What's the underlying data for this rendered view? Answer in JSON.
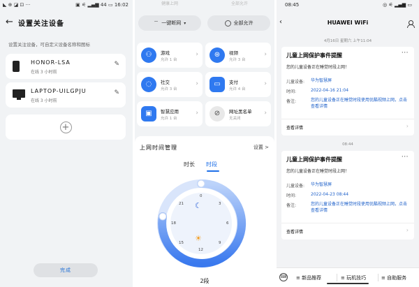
{
  "panel1": {
    "status_left": "◣ ⊕ ◪ ⊡ ···",
    "status_right": "▣ ⚟ ▂▄▆ 44 ▭ 16:02",
    "title": "设置关注设备",
    "description": "设置关注设备，可自定义设备名称和图标",
    "devices": [
      {
        "name": "HONOR-LSA",
        "sub": "在线 3 小时前"
      },
      {
        "name": "LAPTOP-UILGPJU",
        "sub": "在线 3 小时前"
      }
    ],
    "add_symbol": "+",
    "done_label": "完成"
  },
  "panel2": {
    "top_labels": [
      "健康上网",
      "全部允许"
    ],
    "pill1": {
      "label": "一键断网"
    },
    "pill2": {
      "label": "全部允许"
    },
    "tiles": [
      {
        "name": "游戏",
        "sub": "允许 1 台",
        "icon": "game-icon"
      },
      {
        "name": "视频",
        "sub": "允许 3 台",
        "icon": "video-icon"
      },
      {
        "name": "社交",
        "sub": "允许 3 台",
        "icon": "chat-icon"
      },
      {
        "name": "支付",
        "sub": "允许 4 台",
        "icon": "wallet-icon"
      },
      {
        "name": "智慧应用",
        "sub": "允许 1 台",
        "icon": "tv-icon"
      },
      {
        "name": "网址黑名单",
        "sub": "无关闭",
        "icon": "blocklist-icon"
      }
    ],
    "time_mgmt": {
      "title": "上网时间管理",
      "settings": "设置 >",
      "tab_duration": "时长",
      "tab_segment": "时段",
      "dial_numbers": [
        "0",
        "3",
        "6",
        "9",
        "12",
        "15",
        "18",
        "21"
      ],
      "segment_count": "2段"
    }
  },
  "panel3": {
    "time": "08:45",
    "status_right": "◎ ⚟ ▂▄▆ ▭",
    "title": "HUAWEI WiFi",
    "messages": [
      {
        "stamp": "4月16日 星期六 上午11:04",
        "title": "儿童上网保护事件提醒",
        "sub": "您的儿童设备正在睡觉时段上网！",
        "device_key": "儿童设备:",
        "device_val": "华为智慧屏",
        "time_key": "时间:",
        "time_val": "2022-04-16 21:04",
        "note_key": "备注:",
        "note_val": "您的儿童设备正在睡觉时段使用优酷视频上网，点击查看详情",
        "detail": "查看详情"
      },
      {
        "stamp": "08:44",
        "title": "儿童上网保护事件提醒",
        "sub": "您的儿童设备正在睡觉时段上网！",
        "device_key": "儿童设备:",
        "device_val": "华为智慧屏",
        "time_key": "时间:",
        "time_val": "2022-04-23 08:44",
        "note_key": "备注:",
        "note_val": "您的儿童设备正在睡觉时段使用优酷视频上网，点击查看详情",
        "detail": "查看详情"
      }
    ],
    "bottom_bar": [
      "≡ 新品推荐",
      "≡ 玩机技巧",
      "≡ 自助服务"
    ]
  }
}
